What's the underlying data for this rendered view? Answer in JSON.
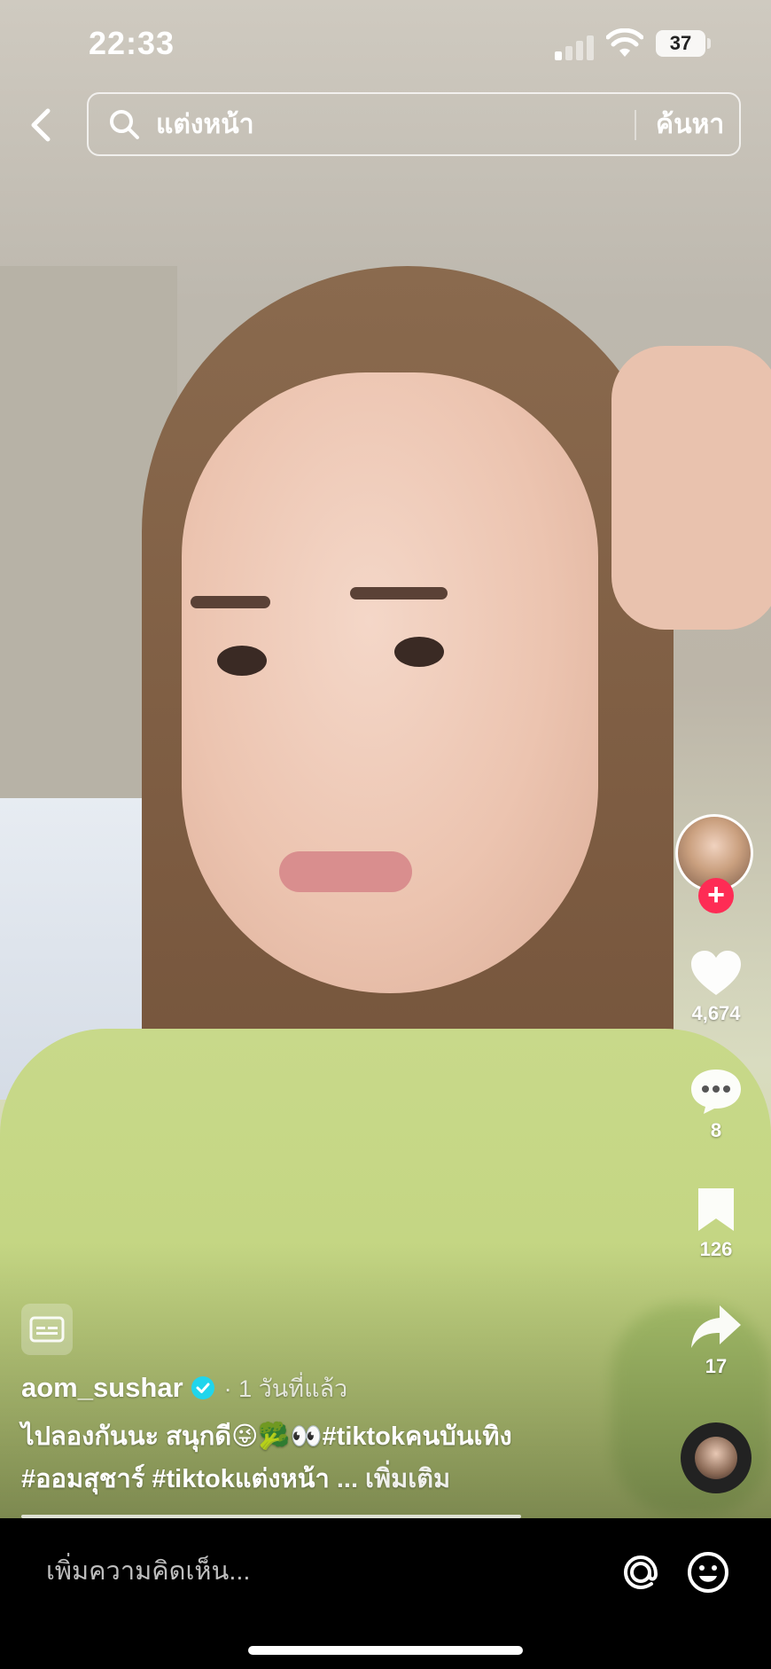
{
  "status_bar": {
    "time": "22:33",
    "battery": "37"
  },
  "search": {
    "query": "แต่งหน้า",
    "button_label": "ค้นหา"
  },
  "rail": {
    "likes": "4,674",
    "comments": "8",
    "saves": "126",
    "shares": "17",
    "follow_symbol": "+"
  },
  "post": {
    "author": "aom_sushar",
    "time_ago": "· 1 วันที่แล้ว",
    "caption_line1": "ไปลองกันนะ สนุกดี😜🥦👀#tiktokคนบันเทิง",
    "caption_line2": "#ออมสุชาร์ #tiktokแต่งหน้า",
    "more_label": "... เพิ่มเติม"
  },
  "comment_bar": {
    "placeholder": "เพิ่มความคิดเห็น..."
  },
  "icons": {
    "back": "chevron-left-icon",
    "search": "search-icon",
    "like": "heart-icon",
    "comment": "comment-icon",
    "save": "bookmark-icon",
    "share": "share-icon",
    "captions": "captions-icon",
    "mention": "at-icon",
    "emoji": "emoji-icon"
  },
  "colors": {
    "follow_badge": "#fe2c55",
    "verified": "#20d5ec"
  }
}
